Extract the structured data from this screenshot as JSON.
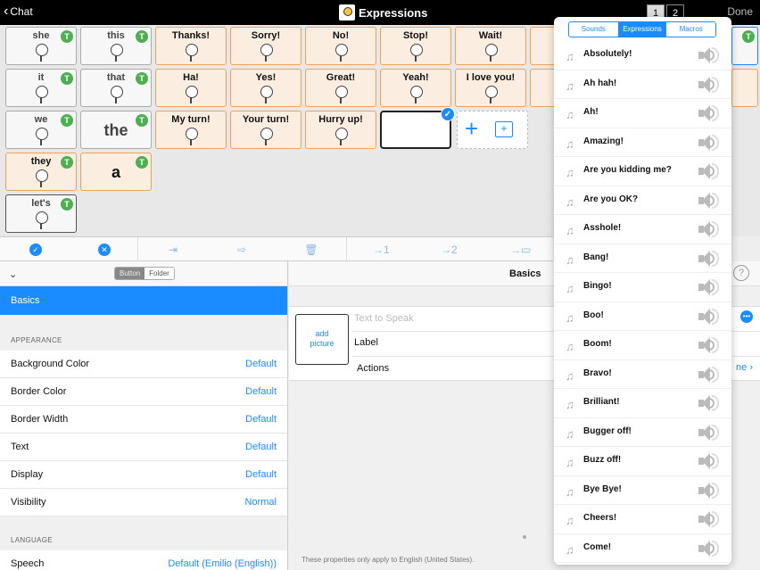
{
  "topbar": {
    "back_label": "Chat",
    "title": "Expressions",
    "pages": [
      "1",
      "2"
    ],
    "done_label": "Done"
  },
  "grid": {
    "row1": [
      "she",
      "this",
      "Thanks!",
      "Sorry!",
      "No!",
      "Stop!",
      "Wait!"
    ],
    "row2": [
      "it",
      "that",
      "Ha!",
      "Yes!",
      "Great!",
      "Yeah!",
      "I love you!"
    ],
    "row3": [
      "we",
      "the",
      "My turn!",
      "Your turn!",
      "Hurry up!"
    ],
    "row4": [
      "they",
      "a"
    ],
    "row5": [
      "let's"
    ],
    "badge": "T"
  },
  "left_panel": {
    "segment": [
      "Button",
      "Folder"
    ],
    "basics": "Basics",
    "appearance_header": "APPEARANCE",
    "appearance": [
      {
        "label": "Background Color",
        "value": "Default"
      },
      {
        "label": "Border Color",
        "value": "Default"
      },
      {
        "label": "Border Width",
        "value": "Default"
      },
      {
        "label": "Text",
        "value": "Default"
      },
      {
        "label": "Display",
        "value": "Default"
      },
      {
        "label": "Visibility",
        "value": "Normal"
      }
    ],
    "language_header": "LANGUAGE",
    "speech": {
      "label": "Speech",
      "value": "Default (Emilio (English))"
    }
  },
  "right_area": {
    "title": "Basics",
    "add_picture": "add\npicture",
    "text_to_speak_placeholder": "Text to Speak",
    "label": "Label",
    "actions": "Actions",
    "truncated_link": "ne",
    "footnote": "These properties only apply to English (United States)."
  },
  "popover": {
    "tabs": [
      "Sounds",
      "Expressions",
      "Macros"
    ],
    "active_tab": "Expressions",
    "items": [
      "Absolutely!",
      "Ah hah!",
      "Ah!",
      "Amazing!",
      "Are you kidding me?",
      "Are you OK?",
      "Asshole!",
      "Bang!",
      "Bingo!",
      "Boo!",
      "Boom!",
      "Bravo!",
      "Brilliant!",
      "Bugger off!",
      "Buzz off!",
      "Bye Bye!",
      "Cheers!",
      "Come!"
    ]
  },
  "colors": {
    "accent": "#1a8cff",
    "badge": "#4caf50",
    "orange_border": "#f0a25a"
  }
}
